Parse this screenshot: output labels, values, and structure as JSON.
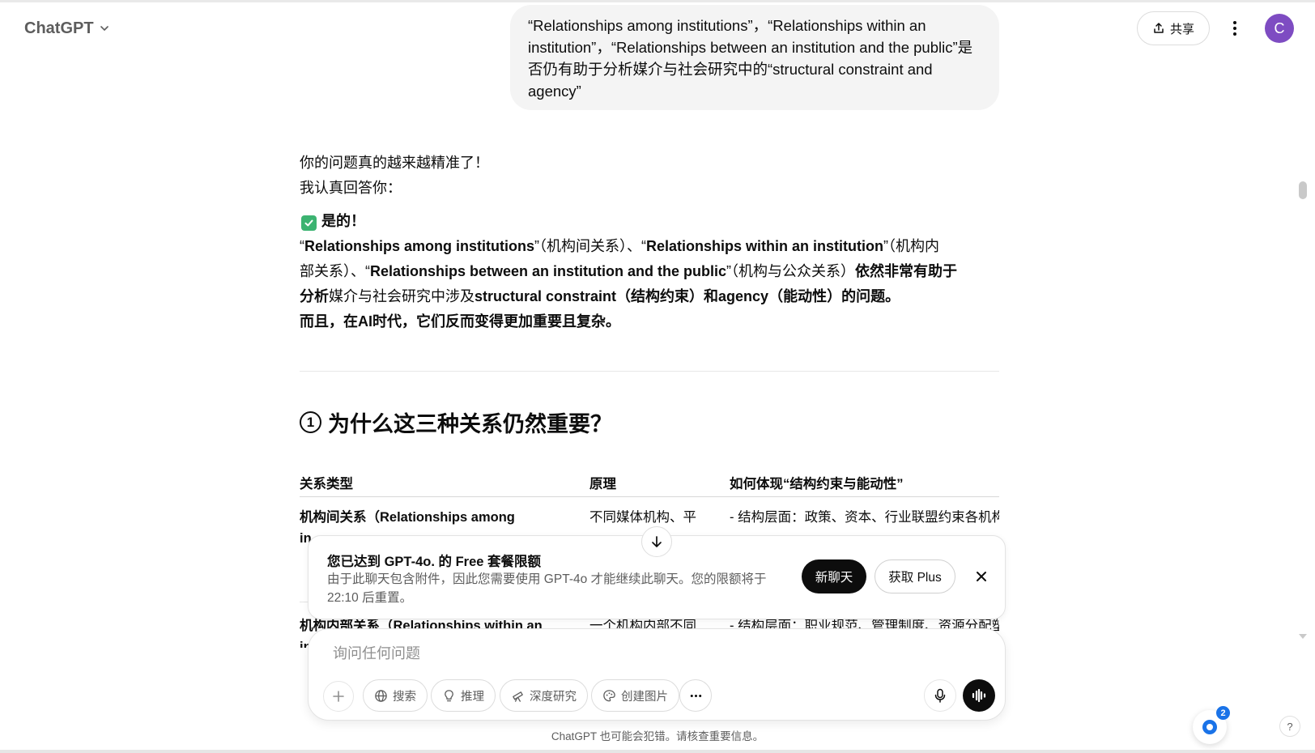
{
  "header": {
    "model_name": "ChatGPT",
    "share_label": "共享",
    "avatar_initial": "C"
  },
  "user_message": {
    "text": "“Relationships among institutions”，“Relationships within an institution”，“Relationships between an institution and the public”是否仍有助于分析媒介与社会研究中的“structural constraint and agency”"
  },
  "answer": {
    "line1": "你的问题真的越来越精准了！",
    "line2": "我认真回答你：",
    "yes_label": "是的！",
    "p1_a": "“",
    "p1_b": "Relationships among institutions",
    "p1_c": "”（机构间关系）、“",
    "p1_d": "Relationships within an institution",
    "p1_e": "”（机构内",
    "p2_a": "部关系）、“",
    "p2_b": "Relationships between an institution and the public",
    "p2_c": "”（机构与公众关系）",
    "p2_d": "依然非常有助于",
    "p3_a": "分析",
    "p3_b": "媒介与社会研究中涉及",
    "p3_c": "structural constraint（结构约束）和agency（能动性）的问题。",
    "p4": "而且，在AI时代，它们反而变得更加重要且复杂。"
  },
  "section": {
    "number": "1",
    "title": "为什么这三种关系仍然重要？"
  },
  "table": {
    "headers": [
      "关系类型",
      "原理",
      "如何体现“结构约束与能动性”"
    ],
    "rows": [
      [
        "机构间关系（Relationships among",
        "不同媒体机构、平",
        "- 结构层面：政策、资本、行业联盟约束各机构"
      ],
      [
        "机构内部关系（Relationships within an",
        "一个机构内部不同",
        "- 结构层面：职业规范、管理制度、资源分配塑"
      ]
    ],
    "row1_wrap": "in",
    "row2_wrap": "in"
  },
  "limit_banner": {
    "title": "您已达到 GPT-4o. 的 Free 套餐限额",
    "description": "由于此聊天包含附件，因此您需要使用 GPT-4o 才能继续此聊天。您的限额将于 22:10 后重置。",
    "new_chat_label": "新聊天",
    "get_plus_label": "获取 Plus"
  },
  "composer": {
    "placeholder": "询问任何问题",
    "tools": [
      {
        "label": "搜索",
        "icon": "globe-icon"
      },
      {
        "label": "推理",
        "icon": "lightbulb-icon"
      },
      {
        "label": "深度研究",
        "icon": "telescope-icon"
      },
      {
        "label": "创建图片",
        "icon": "palette-icon"
      }
    ]
  },
  "disclaimer": "ChatGPT 也可能会犯错。请核查重要信息。",
  "widget_badge": "2",
  "help_label": "?",
  "colors": {
    "avatar": "#7e4cc2",
    "check": "#3cb371",
    "primary_button": "#0d0d0d",
    "badge": "#1a73e8"
  }
}
